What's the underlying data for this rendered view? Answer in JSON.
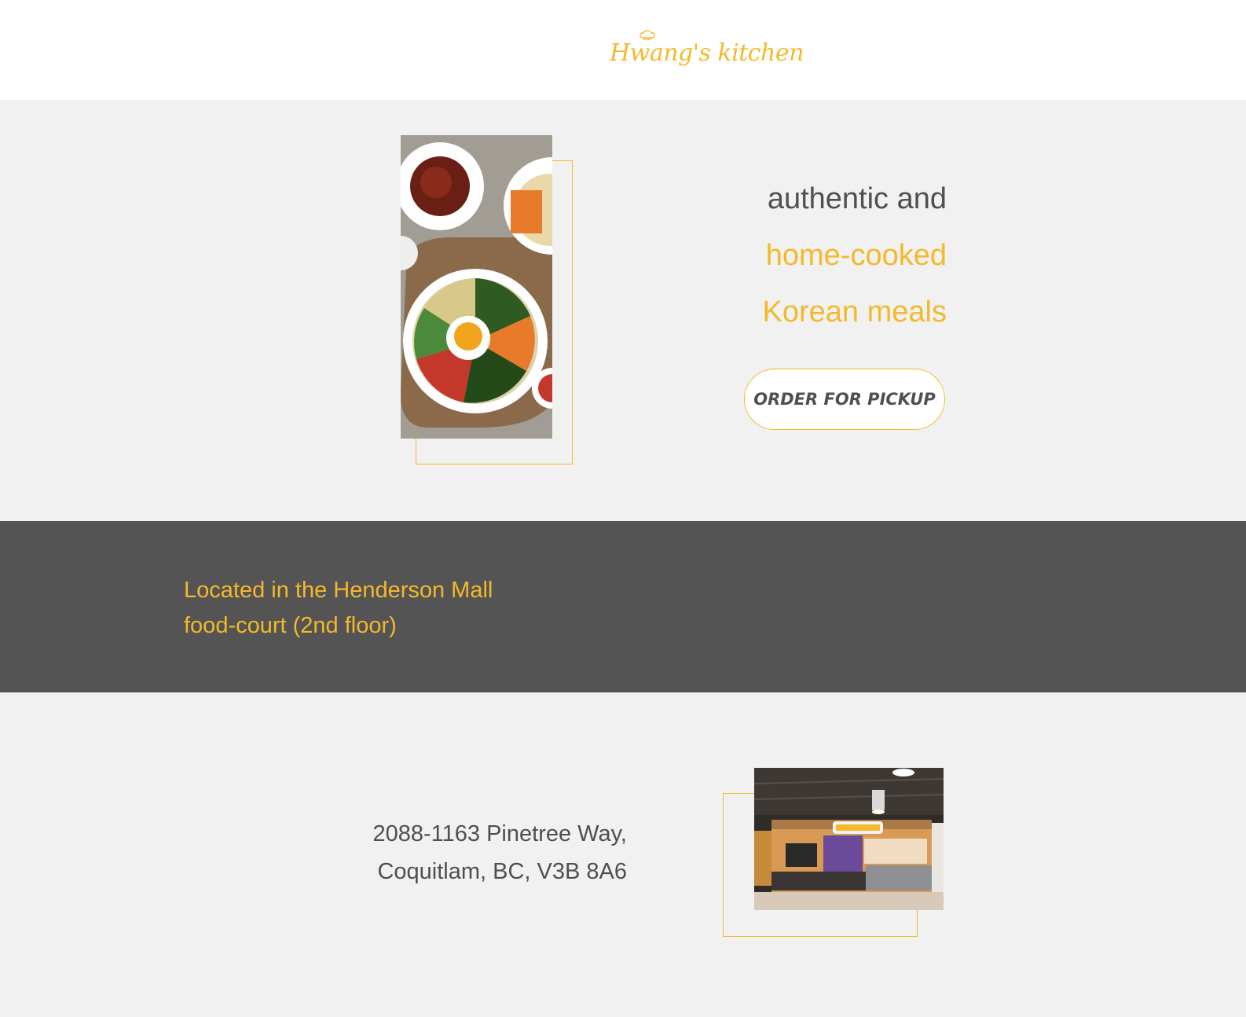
{
  "header": {
    "logo_text": "Hwang's kitchen",
    "logo_icon": "chef-hat-icon"
  },
  "hero": {
    "image_alt": "bibimbap bowl with side dishes",
    "tagline_line1": "authentic and",
    "tagline_line2": "home-cooked",
    "tagline_line3": "Korean meals",
    "order_button_label": "ORDER FOR PICKUP"
  },
  "location": {
    "line1": "Located in the Henderson Mall",
    "line2": "food-court (2nd floor)"
  },
  "address": {
    "line1": "2088-1163 Pinetree Way,",
    "line2": "Coquitlam, BC, V3B 8A6",
    "image_alt": "Hwang's Kitchen storefront in food court"
  },
  "colors": {
    "accent": "#f4b92a",
    "text_dark": "#4f4f4f",
    "page_bg": "#f1f1f1",
    "location_bg": "#545454"
  }
}
